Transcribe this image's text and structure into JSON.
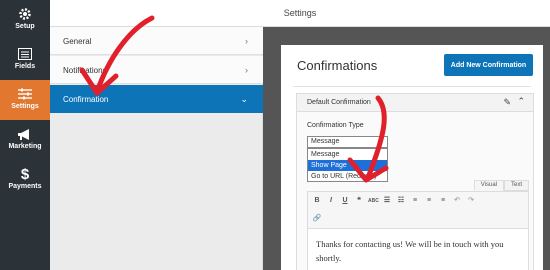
{
  "left_nav": [
    {
      "icon": "gear-icon",
      "label": "Setup"
    },
    {
      "icon": "fields-icon",
      "label": "Fields"
    },
    {
      "icon": "sliders-icon",
      "label": "Settings",
      "active": true
    },
    {
      "icon": "megaphone-icon",
      "label": "Marketing"
    },
    {
      "icon": "dollar-icon",
      "label": "Payments"
    }
  ],
  "header": {
    "title": "Settings"
  },
  "settings_panel": {
    "items": [
      {
        "label": "General",
        "chevron": "›"
      },
      {
        "label": "Notifications",
        "chevron": "›"
      },
      {
        "label": "Confirmation",
        "chevron": "⌄",
        "active": true
      }
    ]
  },
  "confirmations": {
    "title": "Confirmations",
    "add_button": "Add New Confirmation",
    "section_title": "Default Confirmation",
    "type_label": "Confirmation Type",
    "type_select_value": "Message",
    "type_options": [
      "Message",
      "Show Page",
      "Go to URL (Redirect)"
    ],
    "highlighted_option": "Show Page",
    "editor_tabs": [
      "Visual",
      "Text"
    ],
    "message_text": "Thanks for contacting us! We will be in touch with you shortly."
  },
  "colors": {
    "accent": "#e27730",
    "primary": "#0e74b8",
    "annotation": "#e0202a"
  }
}
